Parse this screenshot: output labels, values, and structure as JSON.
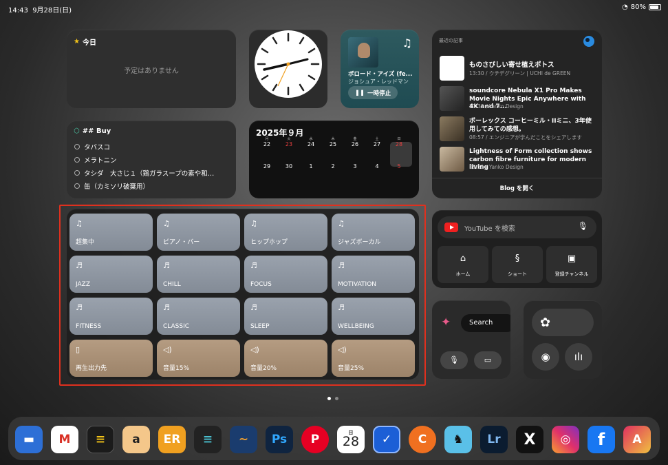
{
  "status": {
    "time": "14:43",
    "date": "9月28日(日)",
    "battery": "80%"
  },
  "today": {
    "title": "今日",
    "empty": "予定はありません"
  },
  "music": {
    "track": "ボロード・アイズ (fe...",
    "artist": "ジョシュア・レッドマン",
    "pause": "一時停止"
  },
  "blog": {
    "header": "最近の記事",
    "articles": [
      {
        "title": "ものさびしい寄せ植えポトス",
        "meta": "13:30 / ウチデグリーン | UCHI de GREEN"
      },
      {
        "title": "soundcore Nebula X1 Pro Makes Movie Nights Epic Anywhere with 4K and 7...",
        "meta": "11:30 / Yanko Design"
      },
      {
        "title": "ボーレックス コーヒーミル・IIミニ、3年使用してみての感想。",
        "meta": "08:57 / エンジニアが学んだことをシェアします"
      },
      {
        "title": "Lightness of Form collection shows carbon fibre furniture for modern living",
        "meta": "08:31 / Yanko Design"
      }
    ],
    "open": "Blog を開く"
  },
  "buy": {
    "title": "## Buy",
    "items": [
      "タバスコ",
      "メラトニン",
      "タシダ　大さじ１（鶏ガラスープの素や和…",
      "缶（カミソリ破棄用）"
    ]
  },
  "calendar": {
    "title": "2025年９月",
    "week1": [
      "22",
      "23",
      "24",
      "25",
      "26",
      "27",
      "28"
    ],
    "week2": [
      "29",
      "30",
      "1",
      "2",
      "3",
      "4",
      "5"
    ],
    "marks": [
      "月",
      "火",
      "水",
      "木",
      "金",
      "土",
      "日"
    ]
  },
  "shortcuts": {
    "row1": [
      "超集中",
      "ピアノ・バー",
      "ヒップホップ",
      "ジャズボーカル"
    ],
    "row2": [
      "JAZZ",
      "CHILL",
      "FOCUS",
      "MOTIVATION"
    ],
    "row3": [
      "FITNESS",
      "CLASSIC",
      "SLEEP",
      "WELLBEING"
    ],
    "row4": [
      "再生出力先",
      "音量15%",
      "音量20%",
      "音量25%"
    ]
  },
  "youtube": {
    "placeholder": "YouTube を検索",
    "tiles": [
      "ホーム",
      "ショート",
      "登録チャンネル"
    ]
  },
  "arc": {
    "search": "Search"
  },
  "dock": {
    "calendar_day": "28",
    "calendar_wd": "日"
  },
  "colors": {
    "highlight": "#e0301e",
    "shortcut_gray": "#8f97a2",
    "shortcut_tan": "#a88f76"
  }
}
